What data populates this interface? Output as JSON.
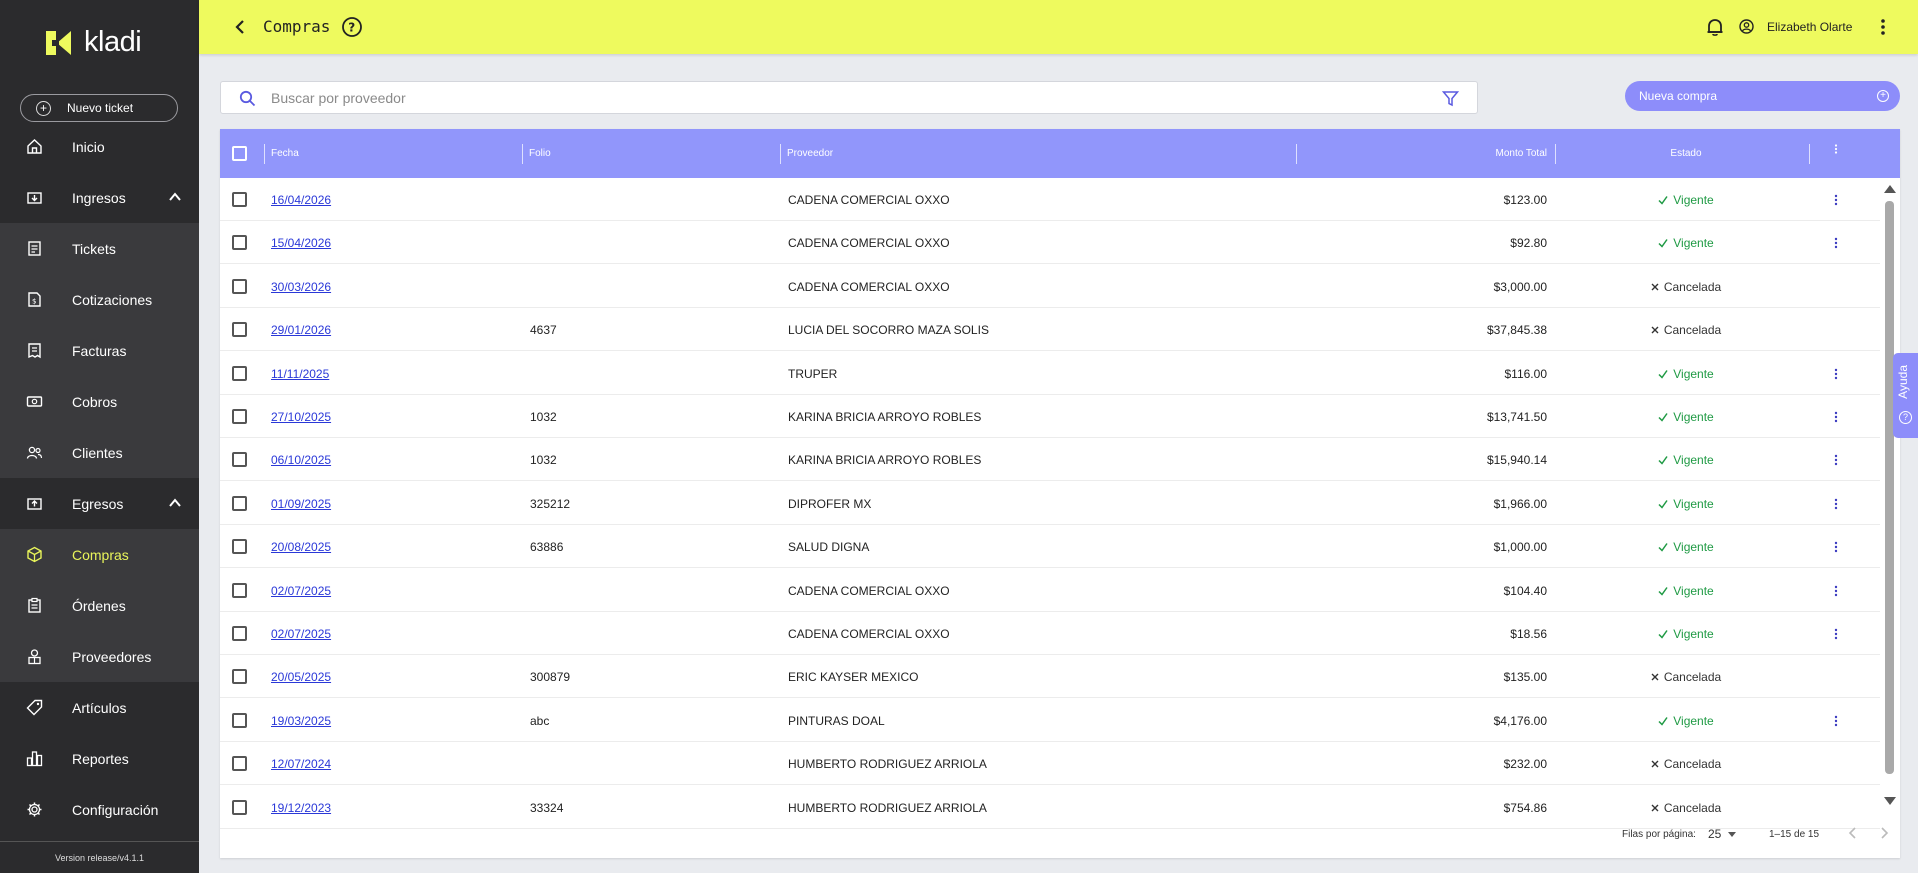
{
  "sidebar": {
    "logo_text": "kladi",
    "new_ticket_label": "Nuevo ticket",
    "items": [
      {
        "label": "Inicio",
        "icon": "home-icon"
      },
      {
        "label": "Ingresos",
        "icon": "income-icon"
      },
      {
        "label": "Tickets",
        "icon": "ticket-icon"
      },
      {
        "label": "Cotizaciones",
        "icon": "quote-icon"
      },
      {
        "label": "Facturas",
        "icon": "invoice-icon"
      },
      {
        "label": "Cobros",
        "icon": "cash-icon"
      },
      {
        "label": "Clientes",
        "icon": "clients-icon"
      },
      {
        "label": "Egresos",
        "icon": "expenses-icon"
      },
      {
        "label": "Compras",
        "icon": "box-icon"
      },
      {
        "label": "Órdenes",
        "icon": "orders-icon"
      },
      {
        "label": "Proveedores",
        "icon": "suppliers-icon"
      },
      {
        "label": "Artículos",
        "icon": "tag-icon"
      },
      {
        "label": "Reportes",
        "icon": "reports-icon"
      },
      {
        "label": "Configuración",
        "icon": "gear-icon"
      }
    ],
    "version": "Version release/v4.1.1"
  },
  "header": {
    "title": "Compras",
    "user_name": "Elizabeth Olarte"
  },
  "search": {
    "placeholder": "Buscar por proveedor"
  },
  "new_purchase_label": "Nueva compra",
  "table": {
    "columns": {
      "fecha": "Fecha",
      "folio": "Folio",
      "proveedor": "Proveedor",
      "monto": "Monto Total",
      "estado": "Estado"
    },
    "rows": [
      {
        "fecha": "16/04/2026",
        "folio": "",
        "proveedor": "CADENA COMERCIAL OXXO",
        "monto": "$123.00",
        "estado": "Vigente",
        "ok": true
      },
      {
        "fecha": "15/04/2026",
        "folio": "",
        "proveedor": "CADENA COMERCIAL OXXO",
        "monto": "$92.80",
        "estado": "Vigente",
        "ok": true
      },
      {
        "fecha": "30/03/2026",
        "folio": "",
        "proveedor": "CADENA COMERCIAL OXXO",
        "monto": "$3,000.00",
        "estado": "Cancelada",
        "ok": false
      },
      {
        "fecha": "29/01/2026",
        "folio": "4637",
        "proveedor": "LUCIA DEL SOCORRO MAZA SOLIS",
        "monto": "$37,845.38",
        "estado": "Cancelada",
        "ok": false
      },
      {
        "fecha": "11/11/2025",
        "folio": "",
        "proveedor": "TRUPER",
        "monto": "$116.00",
        "estado": "Vigente",
        "ok": true
      },
      {
        "fecha": "27/10/2025",
        "folio": "1032",
        "proveedor": "KARINA BRICIA ARROYO ROBLES",
        "monto": "$13,741.50",
        "estado": "Vigente",
        "ok": true
      },
      {
        "fecha": "06/10/2025",
        "folio": "1032",
        "proveedor": "KARINA BRICIA ARROYO ROBLES",
        "monto": "$15,940.14",
        "estado": "Vigente",
        "ok": true
      },
      {
        "fecha": "01/09/2025",
        "folio": "325212",
        "proveedor": "DIPROFER MX",
        "monto": "$1,966.00",
        "estado": "Vigente",
        "ok": true
      },
      {
        "fecha": "20/08/2025",
        "folio": "63886",
        "proveedor": "SALUD DIGNA",
        "monto": "$1,000.00",
        "estado": "Vigente",
        "ok": true
      },
      {
        "fecha": "02/07/2025",
        "folio": "",
        "proveedor": "CADENA COMERCIAL OXXO",
        "monto": "$104.40",
        "estado": "Vigente",
        "ok": true
      },
      {
        "fecha": "02/07/2025",
        "folio": "",
        "proveedor": "CADENA COMERCIAL OXXO",
        "monto": "$18.56",
        "estado": "Vigente",
        "ok": true
      },
      {
        "fecha": "20/05/2025",
        "folio": "300879",
        "proveedor": "ERIC KAYSER MEXICO",
        "monto": "$135.00",
        "estado": "Cancelada",
        "ok": false
      },
      {
        "fecha": "19/03/2025",
        "folio": "abc",
        "proveedor": "PINTURAS DOAL",
        "monto": "$4,176.00",
        "estado": "Vigente",
        "ok": true
      },
      {
        "fecha": "12/07/2024",
        "folio": "",
        "proveedor": "HUMBERTO RODRIGUEZ ARRIOLA",
        "monto": "$232.00",
        "estado": "Cancelada",
        "ok": false
      },
      {
        "fecha": "19/12/2023",
        "folio": "33324",
        "proveedor": "HUMBERTO RODRIGUEZ ARRIOLA",
        "monto": "$754.86",
        "estado": "Cancelada",
        "ok": false
      }
    ]
  },
  "pagination": {
    "rows_per_page_label": "Filas por página:",
    "rows_per_page_value": "25",
    "range": "1–15 de 15"
  },
  "help_tab_label": "Ayuda",
  "colors": {
    "header_bg": "#eefa5e",
    "sidebar_bg": "#2b2b2d",
    "accent": "#8d8dfa",
    "table_header_bg": "#9196fb",
    "active_text": "#e9f55a",
    "ok_status": "#1f9a44",
    "link": "#2a38d8"
  }
}
